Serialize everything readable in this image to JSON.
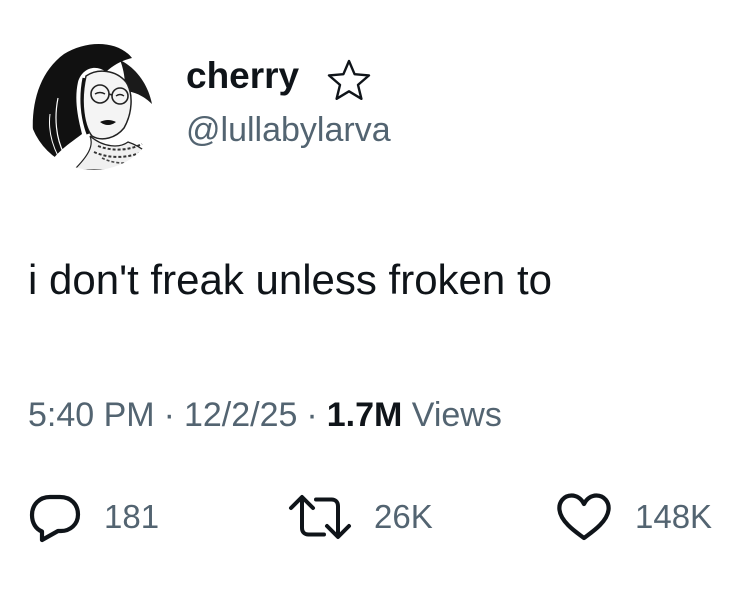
{
  "user": {
    "display_name": "cherry",
    "handle": "@lullabylarva",
    "badge_icon": "star-outline-icon"
  },
  "tweet": {
    "text": "i don't freak unless froken to"
  },
  "meta": {
    "time": "5:40 PM",
    "date": "12/2/25",
    "views_count": "1.7M",
    "views_label": "Views",
    "separator": "·"
  },
  "actions": {
    "replies": "181",
    "reposts": "26K",
    "likes": "148K"
  },
  "colors": {
    "text": "#0f1419",
    "secondary": "#536471",
    "background": "#ffffff"
  }
}
